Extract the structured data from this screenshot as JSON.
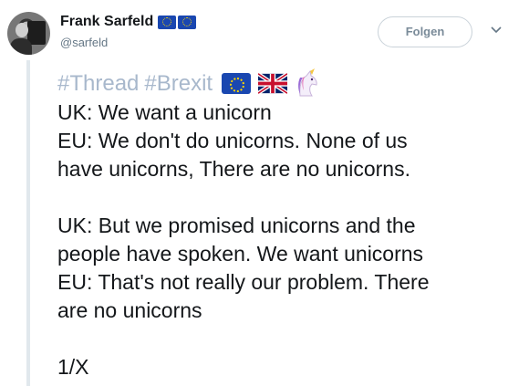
{
  "tweet": {
    "display_name": "Frank Sarfeld",
    "handle": "@sarfeld",
    "follow_label": "Folgen",
    "hashtags": [
      "#Thread",
      "#Brexit"
    ],
    "body_lines": [
      "UK: We want a unicorn",
      "EU: We don't do unicorns. None of us",
      "have unicorns, There are no unicorns.",
      "",
      "UK: But we promised unicorns and the",
      "people have spoken. We want unicorns",
      "EU: That's not really our problem. There",
      "are no unicorns",
      "",
      "1/X"
    ]
  },
  "icons": {
    "name_emoji": [
      "eu-flag",
      "eu-flag"
    ],
    "text_emoji": [
      "eu-flag",
      "uk-flag",
      "unicorn"
    ],
    "menu": "chevron-down-icon"
  },
  "colors": {
    "hashtag": "#a8b8cc",
    "text": "#14171a",
    "handle": "#657786",
    "thread_line": "#e1e8ed"
  }
}
